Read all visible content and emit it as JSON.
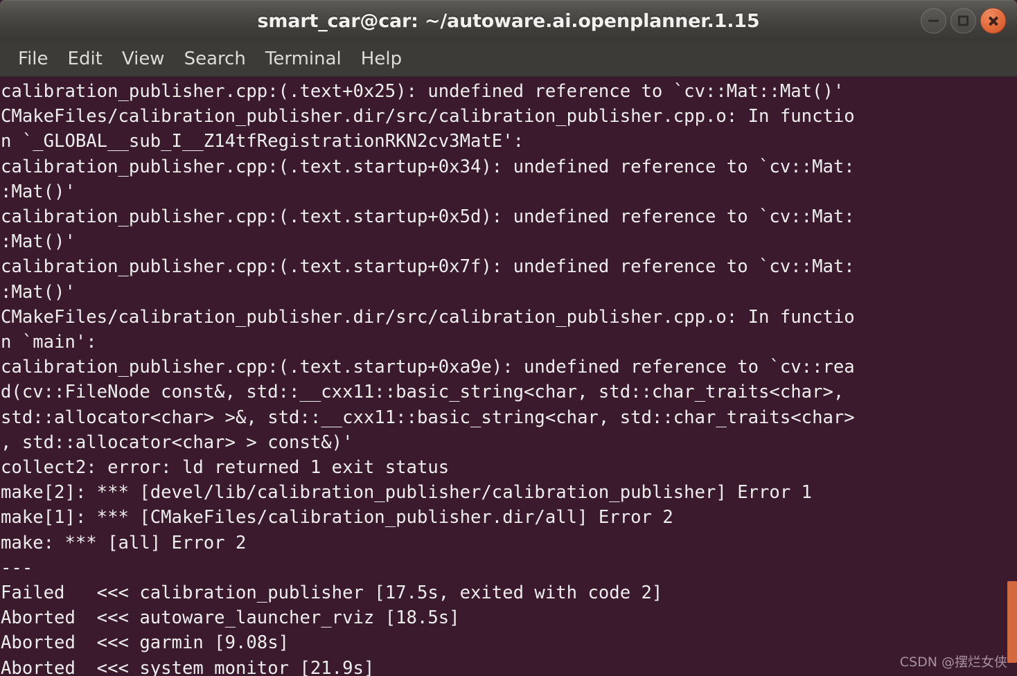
{
  "window": {
    "title": "smart_car@car: ~/autoware.ai.openplanner.1.15",
    "controls": {
      "minimize_label": "minimize",
      "maximize_label": "maximize",
      "close_label": "close"
    }
  },
  "menubar": {
    "items": [
      {
        "label": "File"
      },
      {
        "label": "Edit"
      },
      {
        "label": "View"
      },
      {
        "label": "Search"
      },
      {
        "label": "Terminal"
      },
      {
        "label": "Help"
      }
    ]
  },
  "terminal": {
    "background_color": "#3b1a2e",
    "foreground_color": "#eeeeec",
    "lines": [
      "calibration_publisher.cpp:(.text+0x25): undefined reference to `cv::Mat::Mat()'",
      "CMakeFiles/calibration_publisher.dir/src/calibration_publisher.cpp.o: In functio",
      "n `_GLOBAL__sub_I__Z14tfRegistrationRKN2cv3MatE':",
      "calibration_publisher.cpp:(.text.startup+0x34): undefined reference to `cv::Mat:",
      ":Mat()'",
      "calibration_publisher.cpp:(.text.startup+0x5d): undefined reference to `cv::Mat:",
      ":Mat()'",
      "calibration_publisher.cpp:(.text.startup+0x7f): undefined reference to `cv::Mat:",
      ":Mat()'",
      "CMakeFiles/calibration_publisher.dir/src/calibration_publisher.cpp.o: In functio",
      "n `main':",
      "calibration_publisher.cpp:(.text.startup+0xa9e): undefined reference to `cv::rea",
      "d(cv::FileNode const&, std::__cxx11::basic_string<char, std::char_traits<char>,",
      "std::allocator<char> >&, std::__cxx11::basic_string<char, std::char_traits<char>",
      ", std::allocator<char> > const&)'",
      "collect2: error: ld returned 1 exit status",
      "make[2]: *** [devel/lib/calibration_publisher/calibration_publisher] Error 1",
      "make[1]: *** [CMakeFiles/calibration_publisher.dir/all] Error 2",
      "make: *** [all] Error 2",
      "---",
      "Failed   <<< calibration_publisher [17.5s, exited with code 2]",
      "Aborted  <<< autoware_launcher_rviz [18.5s]",
      "Aborted  <<< garmin [9.08s]",
      "Aborted  <<< system_monitor [21.9s]"
    ]
  },
  "scrollbar": {
    "thumb_color": "#d4683f"
  },
  "watermark": {
    "text": "CSDN @摆烂女侠"
  }
}
